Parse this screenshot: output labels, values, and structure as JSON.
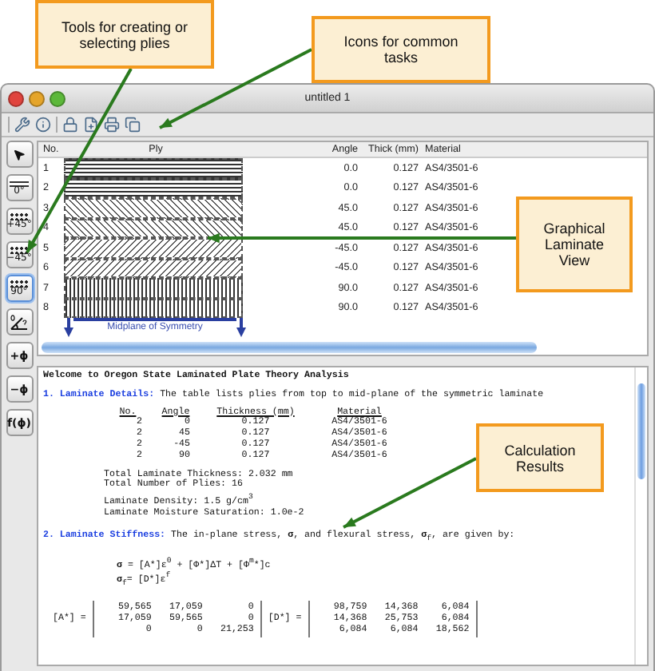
{
  "window": {
    "title": "untitled 1"
  },
  "tools": [
    {
      "kind": "select",
      "selected": false
    },
    {
      "kind": "lines",
      "label": "0°",
      "selected": false
    },
    {
      "kind": "dots",
      "label": "+45°",
      "selected": false
    },
    {
      "kind": "dots",
      "label": "−45°",
      "selected": false
    },
    {
      "kind": "dots",
      "label": "90°",
      "selected": true
    },
    {
      "kind": "angle",
      "selected": false
    },
    {
      "kind": "glyph",
      "label": "+ϕ",
      "selected": false
    },
    {
      "kind": "glyph",
      "label": "−ϕ",
      "selected": false
    },
    {
      "kind": "glyph",
      "label": "f(ϕ)",
      "selected": false
    }
  ],
  "ply_table": {
    "columns": [
      "No.",
      "Ply",
      "Angle",
      "Thick (mm)",
      "Material"
    ],
    "rows": [
      {
        "no": "1",
        "kind": "horizontal",
        "angle": "0.0",
        "thick": "0.127",
        "material": "AS4/3501-6"
      },
      {
        "no": "2",
        "kind": "horizontal",
        "angle": "0.0",
        "thick": "0.127",
        "material": "AS4/3501-6"
      },
      {
        "no": "3",
        "kind": "forward",
        "angle": "45.0",
        "thick": "0.127",
        "material": "AS4/3501-6"
      },
      {
        "no": "4",
        "kind": "forward",
        "angle": "45.0",
        "thick": "0.127",
        "material": "AS4/3501-6"
      },
      {
        "no": "5",
        "kind": "backward",
        "angle": "-45.0",
        "thick": "0.127",
        "material": "AS4/3501-6"
      },
      {
        "no": "6",
        "kind": "backward",
        "angle": "-45.0",
        "thick": "0.127",
        "material": "AS4/3501-6"
      },
      {
        "no": "7",
        "kind": "vertical",
        "angle": "90.0",
        "thick": "0.127",
        "material": "AS4/3501-6"
      },
      {
        "no": "8",
        "kind": "vertical",
        "angle": "90.0",
        "thick": "0.127",
        "material": "AS4/3501-6"
      }
    ],
    "midplane_label": "Midplane of Symmetry"
  },
  "results": {
    "welcome": "Welcome to Oregon State Laminated Plate Theory Analysis",
    "details": {
      "heading": "1. Laminate Details:",
      "text": "The table lists plies from top to mid-plane of the symmetric laminate"
    },
    "summary_table": {
      "columns": [
        "No.",
        "Angle",
        "Thickness (mm)",
        "Material"
      ],
      "rows": [
        [
          "2",
          "0",
          "0.127",
          "AS4/3501-6"
        ],
        [
          "2",
          "45",
          "0.127",
          "AS4/3501-6"
        ],
        [
          "2",
          "-45",
          "0.127",
          "AS4/3501-6"
        ],
        [
          "2",
          "90",
          "0.127",
          "AS4/3501-6"
        ]
      ]
    },
    "totals": [
      "Total Laminate Thickness: 2.032 mm",
      "Total Number of Plies: 16"
    ],
    "properties": [
      "Laminate Density: 1.5 g/cm$^{3}$",
      "Laminate Moisture Saturation: 1.0e-2"
    ],
    "stiffness": {
      "heading": "2. Laminate Stiffness:",
      "text": "The in-plane stress, **σ**, and flexural stress, **σ**$_{f}$, are given by:"
    },
    "equations": [
      "**σ** = [A*]ε$^{0}$ + [Φ*]ΔT + [Φ$^{m}$*]c",
      "**σ**$_{f}$= [D*]ε$^{f}$"
    ],
    "matrices": [
      {
        "label": "[A*] =",
        "rows": [
          [
            "59,565",
            "17,059",
            "0"
          ],
          [
            "17,059",
            "59,565",
            "0"
          ],
          [
            "0",
            "0",
            "21,253"
          ]
        ]
      },
      {
        "label": "[D*] =",
        "rows": [
          [
            "98,759",
            "14,368",
            "6,084"
          ],
          [
            "14,368",
            "25,753",
            "6,084"
          ],
          [
            "6,084",
            "6,084",
            "18,562"
          ]
        ]
      }
    ]
  },
  "callouts": [
    {
      "text": "Tools for creating or selecting plies"
    },
    {
      "text": "Icons for common tasks"
    },
    {
      "text": "Graphical Laminate View"
    },
    {
      "text": "Calculation Results"
    }
  ]
}
